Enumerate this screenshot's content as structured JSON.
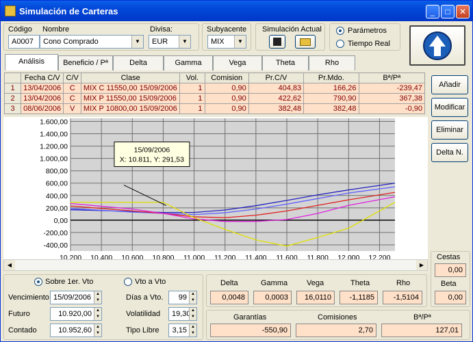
{
  "window": {
    "title": "Simulación de Carteras"
  },
  "header": {
    "codigo_label": "Código",
    "codigo_value": "A0007",
    "nombre_label": "Nombre",
    "nombre_value": "Cono Comprado",
    "divisa_label": "Divisa:",
    "divisa_value": "EUR",
    "subyacente_label": "Subyacente",
    "subyacente_value": "MIX",
    "simulacion_label": "Simulación Actual",
    "radio_parametros": "Parámetros",
    "radio_tiempo_real": "Tiempo Real"
  },
  "tabs": [
    "Análisis",
    "Beneficio / Pª",
    "Delta",
    "Gamma",
    "Vega",
    "Theta",
    "Rho"
  ],
  "table": {
    "columns": [
      "Fecha C/V",
      "C/V",
      "Clase",
      "Vol.",
      "Comision",
      "Pr.C/V",
      "Pr.Mdo.",
      "Bª/Pª"
    ],
    "rows": [
      {
        "n": "1",
        "fecha": "13/04/2006",
        "cv": "C",
        "clase": "MIX C 11550,00 15/09/2006",
        "vol": "1",
        "comision": "0,90",
        "prcv": "404,83",
        "prmdo": "166,26",
        "bp": "-239,47"
      },
      {
        "n": "2",
        "fecha": "13/04/2006",
        "cv": "C",
        "clase": "MIX P 11550,00 15/09/2006",
        "vol": "1",
        "comision": "0,90",
        "prcv": "422,62",
        "prmdo": "790,90",
        "bp": "367,38"
      },
      {
        "n": "3",
        "fecha": "08/06/2006",
        "cv": "V",
        "clase": "MIX P 10800,00 15/09/2006",
        "vol": "1",
        "comision": "0,90",
        "prcv": "382,48",
        "prmdo": "382,48",
        "bp": "-0,90"
      }
    ]
  },
  "side_buttons": {
    "anadir": "Añadir",
    "modificar": "Modificar",
    "eliminar": "Eliminar",
    "delta_n": "Delta N."
  },
  "chart_data": {
    "type": "line",
    "x_ticks": [
      "10.200",
      "10.400",
      "10.600",
      "10.800",
      "11.000",
      "11.200",
      "11.400",
      "11.600",
      "11.800",
      "12.000",
      "12.200"
    ],
    "y_ticks": [
      "1.600,00",
      "1.400,00",
      "1.200,00",
      "1.000,00",
      "800,00",
      "600,00",
      "400,00",
      "200,00",
      "0,00",
      "-200,00",
      "-400,00"
    ],
    "xlim": [
      10200,
      12300
    ],
    "ylim": [
      -500,
      1650
    ],
    "tooltip": {
      "title": "15/09/2006",
      "text": "X: 10.811, Y: 291,53"
    },
    "series": [
      {
        "color": "#2020c0",
        "x": [
          10200,
          10600,
          10800,
          11000,
          11200,
          11400,
          11600,
          11800,
          12000,
          12300
        ],
        "y": [
          170,
          140,
          125,
          125,
          165,
          235,
          320,
          410,
          490,
          600
        ]
      },
      {
        "color": "#6060ff",
        "x": [
          10200,
          10600,
          10800,
          11000,
          11200,
          11400,
          11600,
          11800,
          12000,
          12300
        ],
        "y": [
          190,
          130,
          110,
          90,
          120,
          180,
          260,
          350,
          440,
          540
        ]
      },
      {
        "color": "#e02020",
        "x": [
          10200,
          10600,
          10800,
          11000,
          11200,
          11400,
          11600,
          11800,
          12000,
          12300
        ],
        "y": [
          230,
          150,
          110,
          55,
          40,
          80,
          150,
          240,
          330,
          450
        ]
      },
      {
        "color": "#e020e0",
        "x": [
          10200,
          10600,
          10800,
          11000,
          11200,
          11400,
          11600,
          11800,
          12000,
          12300
        ],
        "y": [
          270,
          180,
          110,
          20,
          -20,
          -20,
          10,
          110,
          240,
          380
        ]
      },
      {
        "color": "#e0e000",
        "x": [
          10200,
          10600,
          10800,
          11000,
          11200,
          11400,
          11600,
          11800,
          12000,
          12300
        ],
        "y": [
          290,
          290,
          290,
          40,
          -150,
          -320,
          -420,
          -280,
          -130,
          290
        ]
      }
    ]
  },
  "cestas": {
    "label": "Cestas",
    "value": "0,00",
    "beta_label": "Beta",
    "beta_value": "0,00"
  },
  "bottom_left": {
    "radio_sobre": "Sobre 1er. Vto",
    "radio_vto": "Vto a Vto",
    "vencimiento_label": "Vencimiento",
    "vencimiento_value": "15/09/2006",
    "futuro_label": "Futuro",
    "futuro_value": "10.920,00",
    "contado_label": "Contado",
    "contado_value": "10.952,60",
    "dias_label": "Días a Vto.",
    "dias_value": "99",
    "volatilidad_label": "Volatilidad",
    "volatilidad_value": "19,30",
    "tipo_label": "Tipo Libre",
    "tipo_value": "3,15"
  },
  "greeks": {
    "delta_label": "Delta",
    "delta_value": "0,0048",
    "gamma_label": "Gamma",
    "gamma_value": "0,0003",
    "vega_label": "Vega",
    "vega_value": "16,0110",
    "theta_label": "Theta",
    "theta_value": "-1,1185",
    "rho_label": "Rho",
    "rho_value": "-1,5104"
  },
  "totals": {
    "garantias_label": "Garantías",
    "garantias_value": "-550,90",
    "comisiones_label": "Comisiones",
    "comisiones_value": "2,70",
    "bp_label": "Bª/Pª",
    "bp_value": "127,01"
  }
}
